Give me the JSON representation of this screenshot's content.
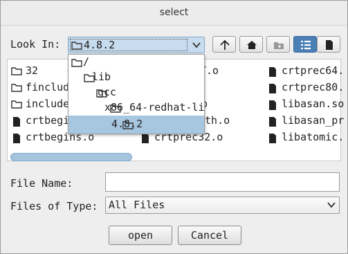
{
  "window": {
    "title": "select"
  },
  "lookin": {
    "label": "Look In:",
    "value": "4.8.2"
  },
  "toolbar": {
    "icons": [
      "up-arrow-icon",
      "home-icon",
      "new-folder-icon",
      "list-view-icon",
      "details-view-icon"
    ]
  },
  "files": [
    {
      "name": "32",
      "type": "folder"
    },
    {
      "name": "finclude",
      "type": "folder"
    },
    {
      "name": "include",
      "type": "folder"
    },
    {
      "name": "crtbegin",
      "type": "file"
    },
    {
      "name": "crtbegins.o",
      "type": "file"
    },
    {
      "name": "T.o",
      "type": "file"
    },
    {
      "name": "o",
      "type": "file"
    },
    {
      "name": "ath.o",
      "type": "file"
    },
    {
      "name": "crtprec32.o",
      "type": "file"
    },
    {
      "name": "crtprec64.",
      "type": "file"
    },
    {
      "name": "crtprec80.",
      "type": "file"
    },
    {
      "name": "libasan.so",
      "type": "file"
    },
    {
      "name": "libasan_pr",
      "type": "file"
    },
    {
      "name": "libatomic.",
      "type": "file"
    }
  ],
  "lookin_dropdown": [
    {
      "name": "/"
    },
    {
      "name": "lib"
    },
    {
      "name": "gcc"
    },
    {
      "name": "x86_64-redhat-li"
    },
    {
      "name": "4.8.2",
      "selected": true
    }
  ],
  "filename": {
    "label": "File Name:",
    "value": ""
  },
  "filetype": {
    "label": "Files of Type:",
    "value": "All Files"
  },
  "buttons": {
    "open": "open",
    "cancel": "Cancel"
  },
  "colors": {
    "selection": "#a7c6e0",
    "accent": "#4a7fb5"
  }
}
